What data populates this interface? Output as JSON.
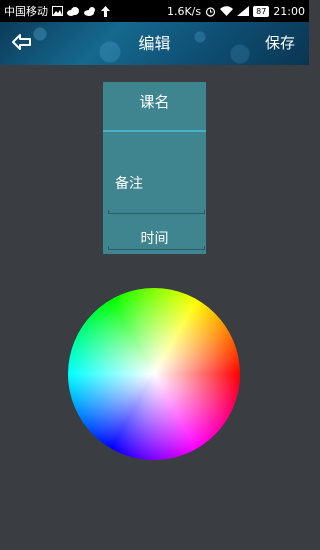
{
  "status_bar": {
    "carrier": "中国移动",
    "speed": "1.6K/s",
    "battery": "87",
    "time": "21:00"
  },
  "action_bar": {
    "title": "编辑",
    "save_label": "保存",
    "back_icon": "back-arrow-icon"
  },
  "form": {
    "course_label": "课名",
    "note_label": "备注",
    "time_label": "时间"
  },
  "colors": {
    "background": "#3a3d42",
    "card": "#3f8590",
    "accent_underline": "#4ab0c6"
  },
  "color_picker": {
    "type": "hue-saturation wheel"
  }
}
